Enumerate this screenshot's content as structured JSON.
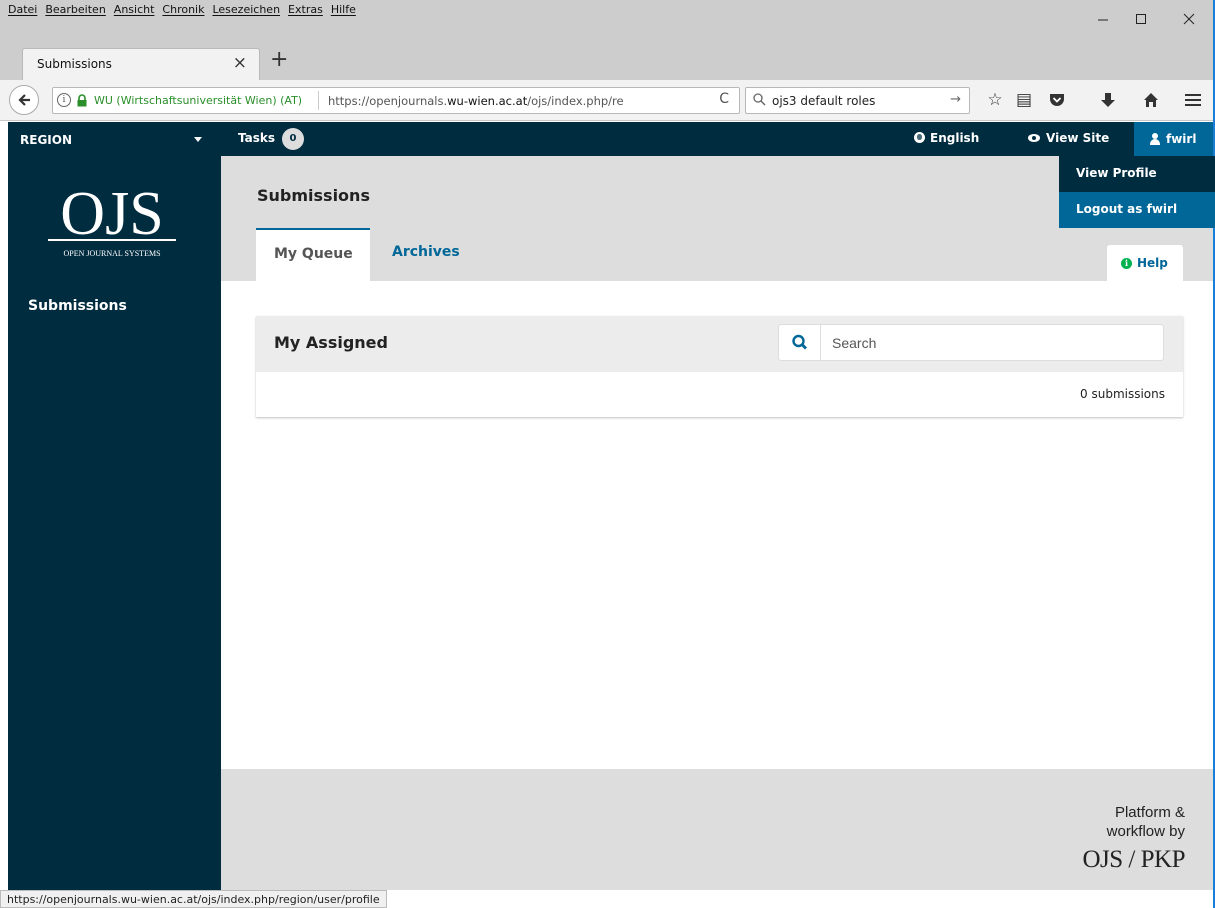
{
  "browser": {
    "menu": [
      "Datei",
      "Bearbeiten",
      "Ansicht",
      "Chronik",
      "Lesezeichen",
      "Extras",
      "Hilfe"
    ],
    "tab_title": "Submissions",
    "identity": "WU (Wirtschaftsuniversität Wien) (AT)",
    "url_prefix": "https://openjournals.",
    "url_domain": "wu-wien.ac.at",
    "url_path": "/ojs/index.php/re",
    "search_query": "ojs3 default roles",
    "status_url": "https://openjournals.wu-wien.ac.at/ojs/index.php/region/user/profile"
  },
  "topnav": {
    "context": "REGION",
    "tasks_label": "Tasks",
    "tasks_count": "0",
    "language": "English",
    "view_site": "View Site",
    "username": "fwirl"
  },
  "user_menu": [
    "View Profile",
    "Logout as fwirl"
  ],
  "logo": {
    "mark": "OJS",
    "caption": "OPEN JOURNAL SYSTEMS"
  },
  "sidebar": {
    "items": [
      "Submissions"
    ]
  },
  "page": {
    "title": "Submissions",
    "tabs": [
      "My Queue",
      "Archives"
    ],
    "help": "Help"
  },
  "panel": {
    "title": "My Assigned",
    "search_placeholder": "Search",
    "count_text": "0 submissions"
  },
  "footer": {
    "line1": "Platform &",
    "line2": "workflow by",
    "logo": "OJS / PKP"
  },
  "colors": {
    "nav": "#002c40",
    "accent": "#006798",
    "help_green": "#00b24e",
    "head_bg": "#dddddd"
  }
}
